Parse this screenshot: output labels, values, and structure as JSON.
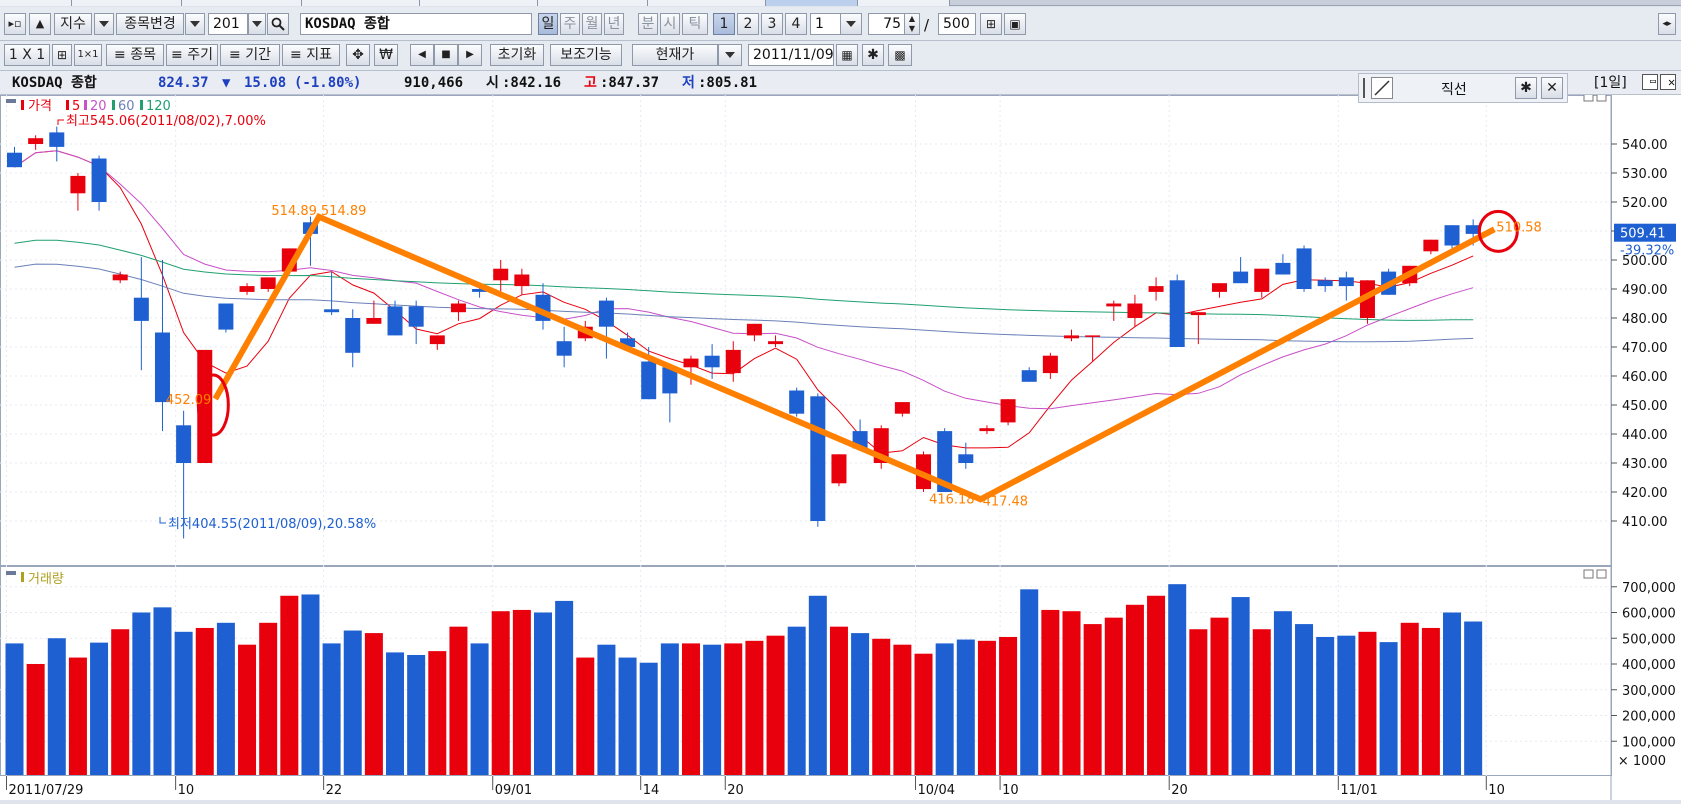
{
  "toolbar1": {
    "index_label": "지수",
    "change_item_label": "종목변경",
    "code_value": "201",
    "name_value": "KOSDAQ 종합",
    "period_tabs": [
      "일",
      "주",
      "월",
      "년",
      "분",
      "시",
      "틱"
    ],
    "chart_tabs": [
      "1",
      "2",
      "3",
      "4"
    ],
    "interval_value": "1",
    "count_value": "75",
    "slash": "/",
    "max_value": "500"
  },
  "toolbar2": {
    "layout_label": "1 X 1",
    "buttons": [
      "종목",
      "주기",
      "기간",
      "지표"
    ],
    "reset_label": "초기화",
    "assist_label": "보조기능",
    "price_type_value": "현재가",
    "date_value": "2011/11/09"
  },
  "info": {
    "name": "KOSDAQ 종합",
    "price": "824.37",
    "change_symbol": "▼",
    "change": "15.08",
    "change_pct": "(-1.80%)",
    "volume": "910,466",
    "open_label": "시",
    "open": ":842.16",
    "high_label": "고",
    "high": ":847.37",
    "low_label": "저",
    "low": ":805.81",
    "period_label": "[1일]"
  },
  "draw_tool": {
    "title": "직선"
  },
  "colors": {
    "up": "#e8000d",
    "down": "#1e60d1",
    "ma5": "#e8000d",
    "ma20": "#c850c8",
    "ma60": "#20a070",
    "ma120": "#6a80b8",
    "trendline": "#ff8000",
    "accent_label": "#ff8000",
    "current_price_bg": "#1e60d1"
  },
  "legend": {
    "price": "가격",
    "ma": [
      "5",
      "20",
      "60",
      "120"
    ]
  },
  "annotations": {
    "high": "최고545.06(2011/08/02),7.00%",
    "low": "최저404.55(2011/08/09),20.58%",
    "p1": "452.09",
    "p2": "514.89",
    "p2b": "514.89",
    "p3": "416.18",
    "p3b": "417.48",
    "p4": "510.58",
    "current_price": "509.41",
    "current_pct": "-39.32%"
  },
  "volume_panel": {
    "title": "거래량",
    "unit_label": "× 1000"
  },
  "chart_data": {
    "type": "candlestick",
    "price_axis": {
      "ticks": [
        410,
        420,
        430,
        440,
        450,
        460,
        470,
        480,
        490,
        500,
        510,
        520,
        530,
        540
      ],
      "tick_labels": [
        "410.00",
        "420.00",
        "430.00",
        "440.00",
        "450.00",
        "460.00",
        "470.00",
        "480.00",
        "490.00",
        "500.00",
        "510.00",
        "520.00",
        "530.00",
        "540.00"
      ]
    },
    "volume_axis": {
      "ticks": [
        100000,
        200000,
        300000,
        400000,
        500000,
        600000,
        700000
      ],
      "tick_labels": [
        "100,000",
        "200,000",
        "300,000",
        "400,000",
        "500,000",
        "600,000",
        "700,000"
      ]
    },
    "x_labels": [
      "2011/07/29",
      "10",
      "22",
      "09/01",
      "14",
      "20",
      "10/04",
      "10",
      "20",
      "11/01",
      "10"
    ],
    "x_label_index": [
      0,
      8,
      15,
      23,
      30,
      34,
      43,
      47,
      55,
      63,
      70
    ],
    "candles": [
      {
        "o": 537,
        "h": 539,
        "l": 532,
        "c": 532,
        "v": 480
      },
      {
        "o": 540,
        "h": 543,
        "l": 538,
        "c": 542,
        "v": 400
      },
      {
        "o": 544,
        "h": 546,
        "l": 534,
        "c": 539,
        "v": 500
      },
      {
        "o": 523,
        "h": 530,
        "l": 517,
        "c": 529,
        "v": 425
      },
      {
        "o": 535,
        "h": 536,
        "l": 517,
        "c": 520,
        "v": 483
      },
      {
        "o": 493,
        "h": 496,
        "l": 492,
        "c": 495,
        "v": 535
      },
      {
        "o": 487,
        "h": 501,
        "l": 462,
        "c": 479,
        "v": 600
      },
      {
        "o": 475,
        "h": 500,
        "l": 441,
        "c": 451,
        "v": 620
      },
      {
        "o": 443,
        "h": 448,
        "l": 404,
        "c": 430,
        "v": 525
      },
      {
        "o": 430,
        "h": 469,
        "l": 430,
        "c": 469,
        "v": 540
      },
      {
        "o": 485,
        "h": 483,
        "l": 475,
        "c": 476,
        "v": 560
      },
      {
        "o": 489,
        "h": 492,
        "l": 488,
        "c": 491,
        "v": 475
      },
      {
        "o": 490,
        "h": 492,
        "l": 489,
        "c": 494,
        "v": 560
      },
      {
        "o": 496,
        "h": 504,
        "l": 495,
        "c": 504,
        "v": 665
      },
      {
        "o": 513,
        "h": 515,
        "l": 498,
        "c": 509,
        "v": 670
      },
      {
        "o": 483,
        "h": 496,
        "l": 481,
        "c": 482,
        "v": 480
      },
      {
        "o": 480,
        "h": 483,
        "l": 463,
        "c": 468,
        "v": 530
      },
      {
        "o": 478,
        "h": 486,
        "l": 478,
        "c": 480,
        "v": 520
      },
      {
        "o": 484,
        "h": 486,
        "l": 477,
        "c": 474,
        "v": 445
      },
      {
        "o": 484,
        "h": 486,
        "l": 471,
        "c": 477,
        "v": 435
      },
      {
        "o": 471,
        "h": 474,
        "l": 469,
        "c": 474,
        "v": 450
      },
      {
        "o": 482,
        "h": 486,
        "l": 479,
        "c": 485,
        "v": 545
      },
      {
        "o": 490,
        "h": 492,
        "l": 487,
        "c": 489,
        "v": 480
      },
      {
        "o": 493,
        "h": 500,
        "l": 489,
        "c": 497,
        "v": 605
      },
      {
        "o": 491,
        "h": 497,
        "l": 488,
        "c": 495,
        "v": 610
      },
      {
        "o": 488,
        "h": 492,
        "l": 476,
        "c": 479,
        "v": 600
      },
      {
        "o": 472,
        "h": 477,
        "l": 463,
        "c": 467,
        "v": 645
      },
      {
        "o": 473,
        "h": 479,
        "l": 472,
        "c": 477,
        "v": 425
      },
      {
        "o": 486,
        "h": 487,
        "l": 466,
        "c": 477,
        "v": 475
      },
      {
        "o": 473,
        "h": 475,
        "l": 469,
        "c": 470,
        "v": 425
      },
      {
        "o": 465,
        "h": 470,
        "l": 452,
        "c": 452,
        "v": 405
      },
      {
        "o": 463,
        "h": 464,
        "l": 444,
        "c": 454,
        "v": 480
      },
      {
        "o": 463,
        "h": 467,
        "l": 457,
        "c": 466,
        "v": 480
      },
      {
        "o": 467,
        "h": 471,
        "l": 459,
        "c": 463,
        "v": 475
      },
      {
        "o": 461,
        "h": 472,
        "l": 458,
        "c": 469,
        "v": 480
      },
      {
        "o": 474,
        "h": 478,
        "l": 472,
        "c": 478,
        "v": 490
      },
      {
        "o": 471,
        "h": 474,
        "l": 470,
        "c": 472,
        "v": 510
      },
      {
        "o": 455,
        "h": 456,
        "l": 446,
        "c": 447,
        "v": 545
      },
      {
        "o": 453,
        "h": 454,
        "l": 408,
        "c": 410,
        "v": 665
      },
      {
        "o": 423,
        "h": 433,
        "l": 422,
        "c": 433,
        "v": 545
      },
      {
        "o": 441,
        "h": 445,
        "l": 436,
        "c": 435,
        "v": 520
      },
      {
        "o": 430,
        "h": 443,
        "l": 428,
        "c": 442,
        "v": 498
      },
      {
        "o": 447,
        "h": 451,
        "l": 446,
        "c": 451,
        "v": 475
      },
      {
        "o": 421,
        "h": 434,
        "l": 420,
        "c": 433,
        "v": 440
      },
      {
        "o": 441,
        "h": 442,
        "l": 420,
        "c": 420,
        "v": 480
      },
      {
        "o": 433,
        "h": 437,
        "l": 428,
        "c": 430,
        "v": 495
      },
      {
        "o": 441,
        "h": 443,
        "l": 440,
        "c": 442,
        "v": 490
      },
      {
        "o": 444,
        "h": 452,
        "l": 443,
        "c": 452,
        "v": 505
      },
      {
        "o": 462,
        "h": 463,
        "l": 458,
        "c": 458,
        "v": 690
      },
      {
        "o": 461,
        "h": 468,
        "l": 459,
        "c": 467,
        "v": 610
      },
      {
        "o": 473,
        "h": 476,
        "l": 472,
        "c": 474,
        "v": 605
      },
      {
        "o": 474,
        "h": 474,
        "l": 465,
        "c": 474,
        "v": 555
      },
      {
        "o": 484,
        "h": 486,
        "l": 479,
        "c": 485,
        "v": 580
      },
      {
        "o": 480,
        "h": 488,
        "l": 477,
        "c": 485,
        "v": 630
      },
      {
        "o": 489,
        "h": 494,
        "l": 486,
        "c": 491,
        "v": 665
      },
      {
        "o": 493,
        "h": 495,
        "l": 470,
        "c": 470,
        "v": 710
      },
      {
        "o": 481,
        "h": 482,
        "l": 471,
        "c": 482,
        "v": 535
      },
      {
        "o": 489,
        "h": 492,
        "l": 487,
        "c": 492,
        "v": 580
      },
      {
        "o": 496,
        "h": 501,
        "l": 492,
        "c": 492,
        "v": 660
      },
      {
        "o": 489,
        "h": 497,
        "l": 487,
        "c": 497,
        "v": 535
      },
      {
        "o": 499,
        "h": 502,
        "l": 495,
        "c": 495,
        "v": 605
      },
      {
        "o": 504,
        "h": 505,
        "l": 489,
        "c": 490,
        "v": 555
      },
      {
        "o": 493,
        "h": 494,
        "l": 489,
        "c": 491,
        "v": 505
      },
      {
        "o": 494,
        "h": 496,
        "l": 486,
        "c": 491,
        "v": 510
      },
      {
        "o": 480,
        "h": 493,
        "l": 478,
        "c": 493,
        "v": 525
      },
      {
        "o": 496,
        "h": 497,
        "l": 488,
        "c": 488,
        "v": 485
      },
      {
        "o": 492,
        "h": 498,
        "l": 491,
        "c": 498,
        "v": 560
      },
      {
        "o": 503,
        "h": 507,
        "l": 502,
        "c": 507,
        "v": 540
      },
      {
        "o": 512,
        "h": 512,
        "l": 504,
        "c": 505,
        "v": 600
      },
      {
        "o": 512,
        "h": 514,
        "l": 505,
        "c": 509,
        "v": 565
      }
    ],
    "trendline": [
      {
        "i": 9.5,
        "p": 452.09
      },
      {
        "i": 14.4,
        "p": 514.89
      },
      {
        "i": 45.7,
        "p": 417.48
      },
      {
        "i": 70,
        "p": 510.58
      }
    ]
  }
}
